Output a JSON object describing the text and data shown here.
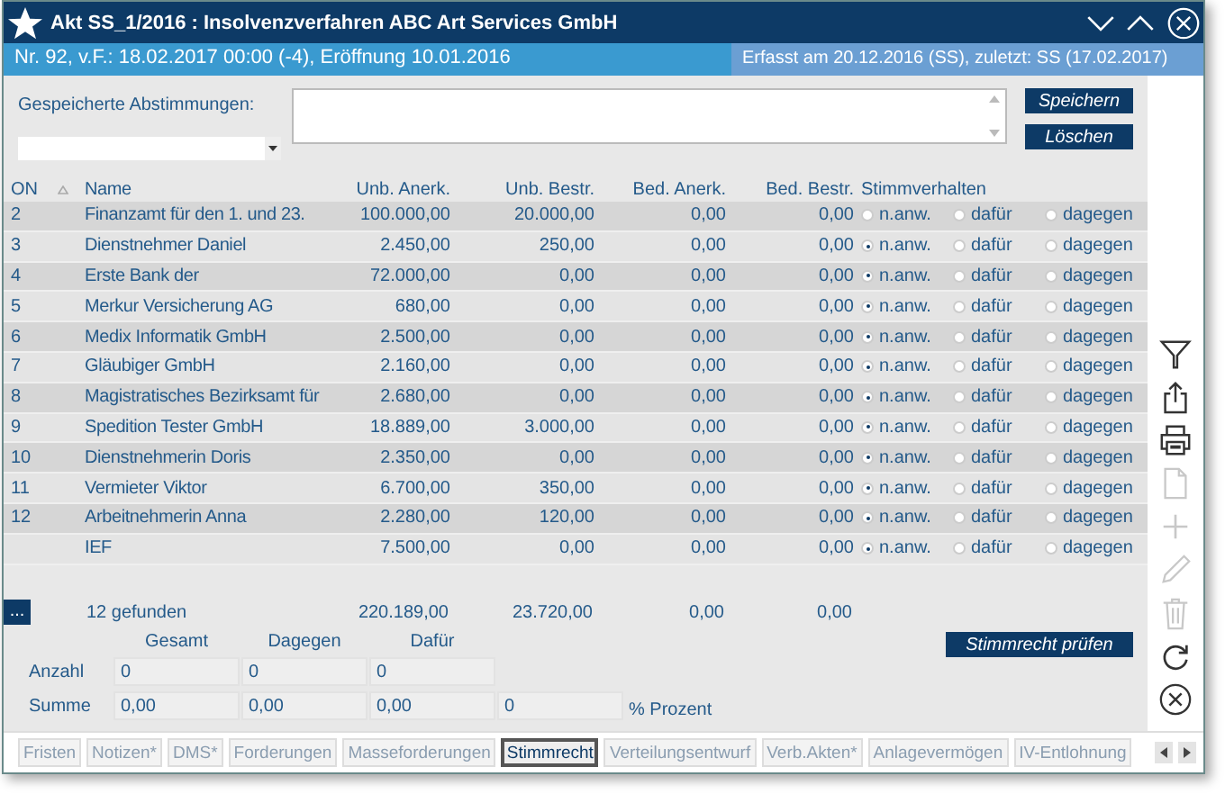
{
  "window": {
    "title": "Akt SS_1/2016 : Insolvenzverfahren ABC Art Services GmbH"
  },
  "info_bar": {
    "left": "Nr. 92, v.F.: 18.02.2017 00:00 (-4), Eröffnung 10.01.2016",
    "right": "Erfasst am 20.12.2016 (SS), zuletzt: SS (17.02.2017)"
  },
  "saved_votes": {
    "label": "Gespeicherte Abstimmungen:",
    "buttons": [
      "Speichern",
      "Löschen"
    ]
  },
  "table": {
    "columns": [
      "ON",
      "Name",
      "Unb. Anerk.",
      "Unb. Bestr.",
      "Bed. Anerk.",
      "Bed. Bestr.",
      "Stimmverhalten"
    ],
    "rows": [
      {
        "on": "2",
        "name": "Finanzamt für den 1. und 23.",
        "unb_anerk": "100.000,00",
        "unb_bestr": "20.000,00",
        "bed_anerk": "0,00",
        "bed_bestr": "0,00",
        "votes": [
          {
            "label": "n.anw.",
            "selected": false
          },
          {
            "label": "dafür",
            "selected": false
          },
          {
            "label": "dagegen",
            "selected": false
          }
        ]
      },
      {
        "on": "3",
        "name": "Dienstnehmer Daniel",
        "unb_anerk": "2.450,00",
        "unb_bestr": "250,00",
        "bed_anerk": "0,00",
        "bed_bestr": "0,00",
        "votes": [
          {
            "label": "n.anw.",
            "selected": true
          },
          {
            "label": "dafür",
            "selected": false
          },
          {
            "label": "dagegen",
            "selected": false
          }
        ]
      },
      {
        "on": "4",
        "name": "Erste Bank der",
        "unb_anerk": "72.000,00",
        "unb_bestr": "0,00",
        "bed_anerk": "0,00",
        "bed_bestr": "0,00",
        "votes": [
          {
            "label": "n.anw.",
            "selected": true
          },
          {
            "label": "dafür",
            "selected": false
          },
          {
            "label": "dagegen",
            "selected": false
          }
        ]
      },
      {
        "on": "5",
        "name": "Merkur Versicherung AG",
        "unb_anerk": "680,00",
        "unb_bestr": "0,00",
        "bed_anerk": "0,00",
        "bed_bestr": "0,00",
        "votes": [
          {
            "label": "n.anw.",
            "selected": true
          },
          {
            "label": "dafür",
            "selected": false
          },
          {
            "label": "dagegen",
            "selected": false
          }
        ]
      },
      {
        "on": "6",
        "name": "Medix Informatik GmbH",
        "unb_anerk": "2.500,00",
        "unb_bestr": "0,00",
        "bed_anerk": "0,00",
        "bed_bestr": "0,00",
        "votes": [
          {
            "label": "n.anw.",
            "selected": true
          },
          {
            "label": "dafür",
            "selected": false
          },
          {
            "label": "dagegen",
            "selected": false
          }
        ]
      },
      {
        "on": "7",
        "name": "Gläubiger GmbH",
        "unb_anerk": "2.160,00",
        "unb_bestr": "0,00",
        "bed_anerk": "0,00",
        "bed_bestr": "0,00",
        "votes": [
          {
            "label": "n.anw.",
            "selected": true
          },
          {
            "label": "dafür",
            "selected": false
          },
          {
            "label": "dagegen",
            "selected": false
          }
        ]
      },
      {
        "on": "8",
        "name": "Magistratisches Bezirksamt für",
        "unb_anerk": "2.680,00",
        "unb_bestr": "0,00",
        "bed_anerk": "0,00",
        "bed_bestr": "0,00",
        "votes": [
          {
            "label": "n.anw.",
            "selected": true
          },
          {
            "label": "dafür",
            "selected": false
          },
          {
            "label": "dagegen",
            "selected": false
          }
        ]
      },
      {
        "on": "9",
        "name": "Spedition Tester GmbH",
        "unb_anerk": "18.889,00",
        "unb_bestr": "3.000,00",
        "bed_anerk": "0,00",
        "bed_bestr": "0,00",
        "votes": [
          {
            "label": "n.anw.",
            "selected": true
          },
          {
            "label": "dafür",
            "selected": false
          },
          {
            "label": "dagegen",
            "selected": false
          }
        ]
      },
      {
        "on": "10",
        "name": "Dienstnehmerin Doris",
        "unb_anerk": "2.350,00",
        "unb_bestr": "0,00",
        "bed_anerk": "0,00",
        "bed_bestr": "0,00",
        "votes": [
          {
            "label": "n.anw.",
            "selected": true
          },
          {
            "label": "dafür",
            "selected": false
          },
          {
            "label": "dagegen",
            "selected": false
          }
        ]
      },
      {
        "on": "11",
        "name": "Vermieter Viktor",
        "unb_anerk": "6.700,00",
        "unb_bestr": "350,00",
        "bed_anerk": "0,00",
        "bed_bestr": "0,00",
        "votes": [
          {
            "label": "n.anw.",
            "selected": true
          },
          {
            "label": "dafür",
            "selected": false
          },
          {
            "label": "dagegen",
            "selected": false
          }
        ]
      },
      {
        "on": "12",
        "name": "Arbeitnehmerin Anna",
        "unb_anerk": "2.280,00",
        "unb_bestr": "120,00",
        "bed_anerk": "0,00",
        "bed_bestr": "0,00",
        "votes": [
          {
            "label": "n.anw.",
            "selected": true
          },
          {
            "label": "dafür",
            "selected": false
          },
          {
            "label": "dagegen",
            "selected": false
          }
        ]
      },
      {
        "on": "",
        "name": "IEF",
        "unb_anerk": "7.500,00",
        "unb_bestr": "0,00",
        "bed_anerk": "0,00",
        "bed_bestr": "0,00",
        "votes": [
          {
            "label": "n.anw.",
            "selected": true
          },
          {
            "label": "dafür",
            "selected": false
          },
          {
            "label": "dagegen",
            "selected": false
          }
        ]
      }
    ],
    "more_button": "...",
    "found": "12 gefunden",
    "totals": [
      "220.189,00",
      "23.720,00",
      "0,00",
      "0,00"
    ]
  },
  "summary": {
    "columns": [
      "Gesamt",
      "Dagegen",
      "Dafür"
    ],
    "rows": [
      {
        "label": "Anzahl",
        "values": [
          "0",
          "0",
          "0"
        ]
      },
      {
        "label": "Summe",
        "values": [
          "0,00",
          "0,00",
          "0,00",
          "0"
        ],
        "suffix": "% Prozent"
      }
    ],
    "check_button": "Stimmrecht prüfen"
  },
  "toolbar": [
    {
      "kind": "filter",
      "disabled": false
    },
    {
      "kind": "share",
      "disabled": false
    },
    {
      "kind": "print",
      "disabled": false
    },
    {
      "kind": "document",
      "disabled": true
    },
    {
      "kind": "add",
      "disabled": true
    },
    {
      "kind": "edit",
      "disabled": true
    },
    {
      "kind": "delete",
      "disabled": true
    },
    {
      "kind": "refresh",
      "disabled": false
    },
    {
      "kind": "close",
      "disabled": false
    }
  ],
  "tabs": [
    {
      "label": "Fristen",
      "selected": false
    },
    {
      "label": "Notizen*",
      "selected": false
    },
    {
      "label": "DMS*",
      "selected": false
    },
    {
      "label": "Forderungen",
      "selected": false
    },
    {
      "label": "Masseforderungen",
      "selected": false
    },
    {
      "label": "Stimmrecht",
      "selected": true
    },
    {
      "label": "Verteilungsentwurf",
      "selected": false
    },
    {
      "label": "Verb.Akten*",
      "selected": false
    },
    {
      "label": "Anlagevermögen",
      "selected": false
    },
    {
      "label": "IV-Entlohnung",
      "selected": false
    }
  ]
}
